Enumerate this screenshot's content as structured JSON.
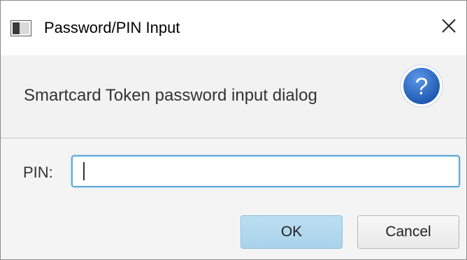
{
  "window": {
    "title": "Password/PIN Input",
    "close_glyph": "✕"
  },
  "header": {
    "text": "Smartcard Token password input dialog",
    "icon": "question-mark-icon",
    "icon_glyph": "?"
  },
  "form": {
    "pin_label": "PIN:",
    "pin_value": ""
  },
  "buttons": {
    "ok_label": "OK",
    "cancel_label": "Cancel"
  },
  "colors": {
    "accent": "#5ea8d8",
    "default_button": "#a9d2ea",
    "help_icon": "#2e6cc4"
  }
}
